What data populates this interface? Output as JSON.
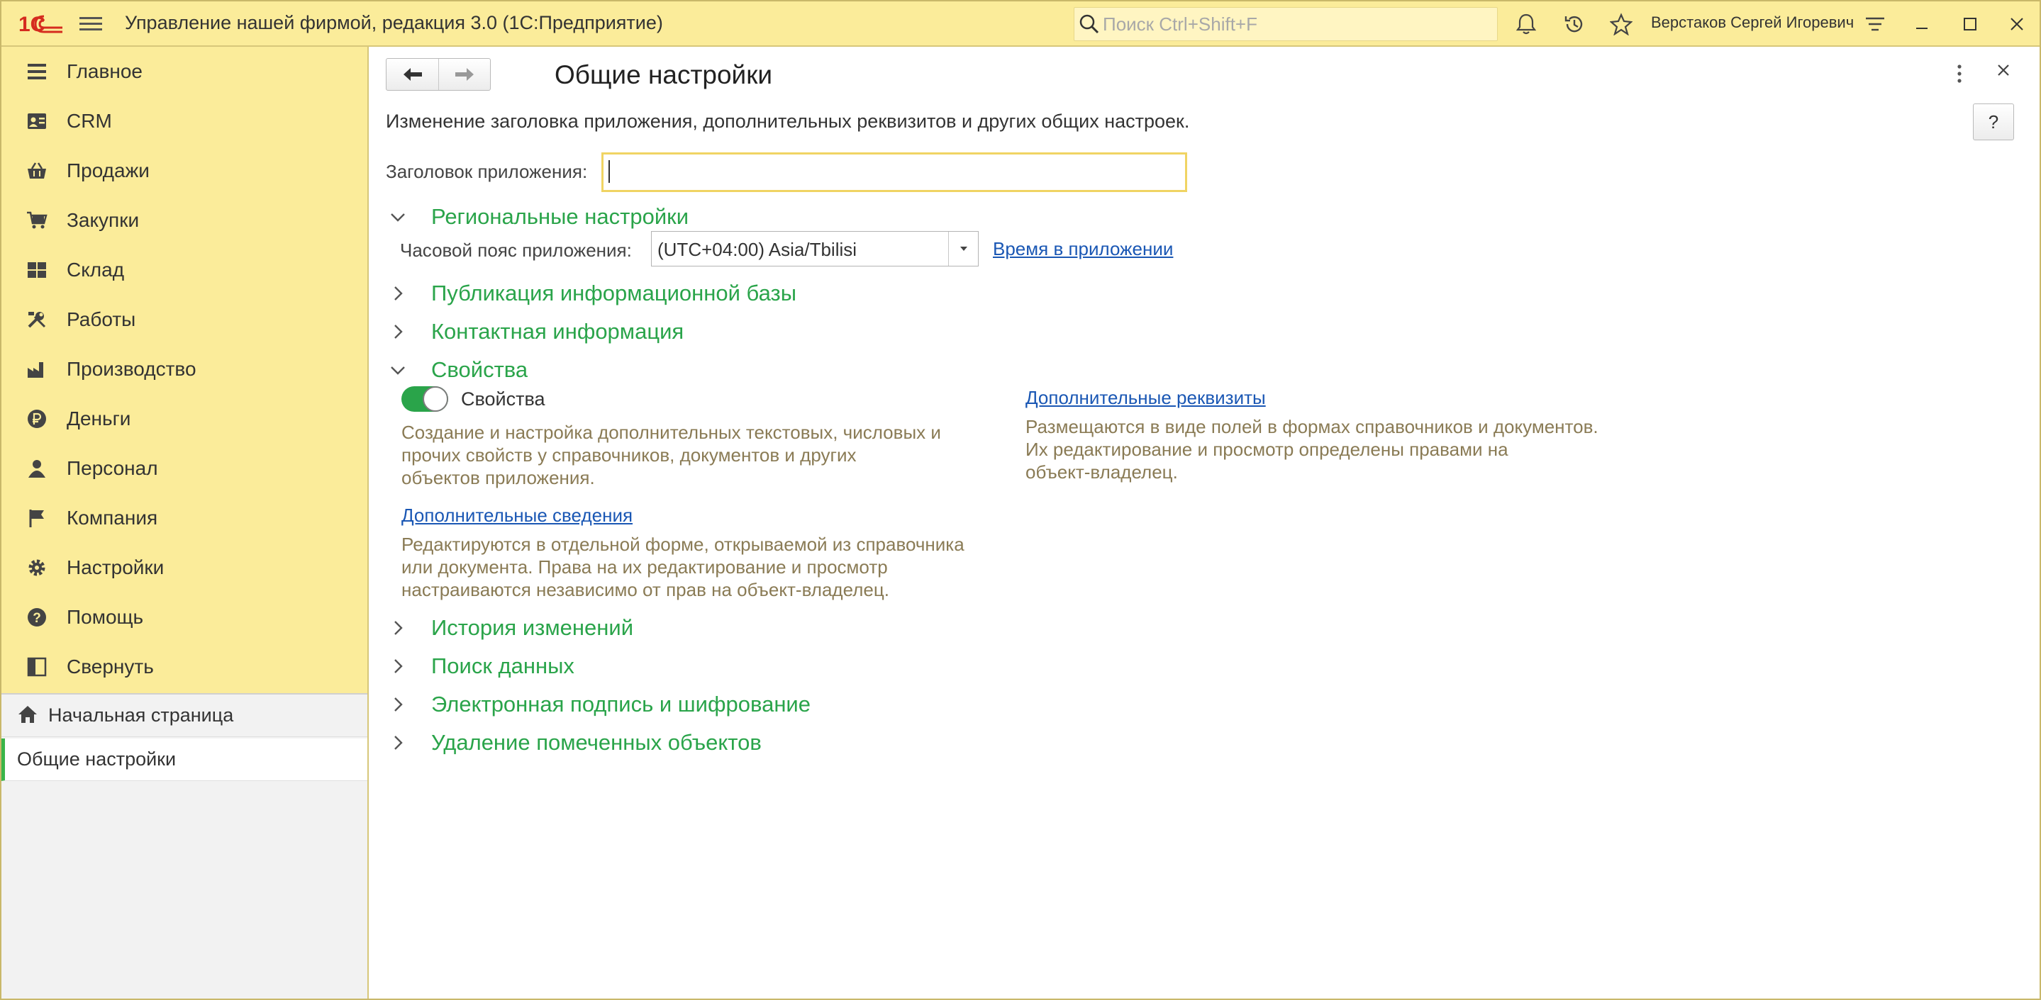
{
  "titlebar": {
    "logo_text": "1С",
    "app_title": "Управление нашей фирмой, редакция 3.0  (1С:Предприятие)",
    "search_placeholder": "Поиск Ctrl+Shift+F",
    "user_name": "Верстаков Сергей Игоревич",
    "icons": [
      "bell-icon",
      "history-icon",
      "star-icon",
      "settings-lines-icon",
      "minimize-icon",
      "maximize-icon",
      "close-icon"
    ]
  },
  "sidebar": {
    "items": [
      {
        "label": "Главное",
        "icon": "list-icon"
      },
      {
        "label": "CRM",
        "icon": "contacts-icon"
      },
      {
        "label": "Продажи",
        "icon": "basket-icon"
      },
      {
        "label": "Закупки",
        "icon": "cart-icon"
      },
      {
        "label": "Склад",
        "icon": "warehouse-icon"
      },
      {
        "label": "Работы",
        "icon": "tools-icon"
      },
      {
        "label": "Производство",
        "icon": "factory-icon"
      },
      {
        "label": "Деньги",
        "icon": "ruble-icon"
      },
      {
        "label": "Персонал",
        "icon": "person-icon"
      },
      {
        "label": "Компания",
        "icon": "flag-icon"
      },
      {
        "label": "Настройки",
        "icon": "gear-icon"
      },
      {
        "label": "Помощь",
        "icon": "help-icon"
      },
      {
        "label": "Свернуть",
        "icon": "collapse-icon"
      }
    ],
    "open_windows": {
      "home": "Начальная страница",
      "active": "Общие настройки"
    }
  },
  "main": {
    "title": "Общие настройки",
    "help_label": "?",
    "description": "Изменение заголовка приложения, дополнительных реквизитов и других общих настроек.",
    "app_title_label": "Заголовок приложения:",
    "app_title_value": "",
    "sections": {
      "regional": "Региональные настройки",
      "publication": "Публикация информационной базы",
      "contacts": "Контактная информация",
      "properties": "Свойства",
      "history": "История изменений",
      "data_search": "Поиск данных",
      "signature": "Электронная подпись и шифрование",
      "deletion": "Удаление помеченных объектов"
    },
    "regional": {
      "tz_label": "Часовой пояс приложения:",
      "tz_value": "(UTC+04:00) Asia/Tbilisi",
      "time_link": "Время в приложении"
    },
    "properties": {
      "toggle_label": "Свойства",
      "toggle_on": true,
      "toggle_desc": [
        "Создание и настройка дополнительных текстовых, числовых и",
        "прочих свойств у справочников, документов и других",
        "объектов приложения."
      ],
      "info_link": "Дополнительные сведения",
      "info_desc": [
        "Редактируются в отдельной форме, открываемой из справочника",
        "или документа. Права на их редактирование и просмотр",
        "настраиваются независимо от прав на объект-владелец."
      ],
      "attr_link": "Дополнительные реквизиты",
      "attr_desc": [
        "Размещаются в виде полей в формах справочников и документов.",
        "Их редактирование и просмотр определены правами на",
        "объект-владелец."
      ]
    }
  }
}
